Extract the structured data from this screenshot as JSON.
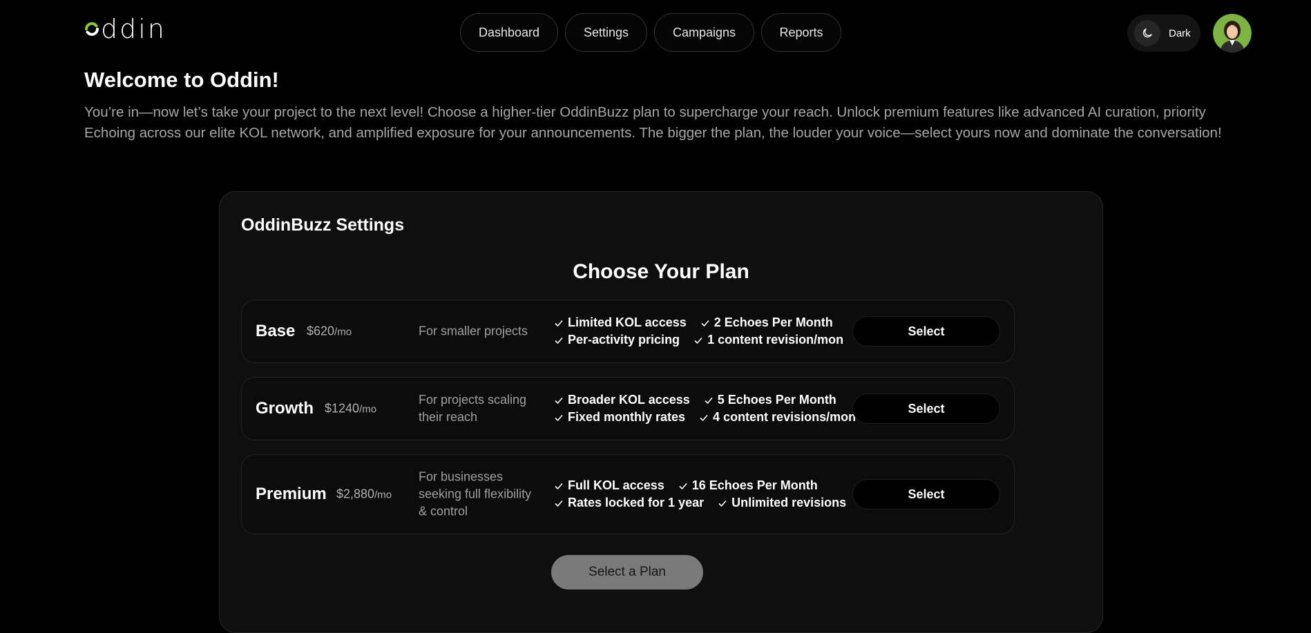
{
  "header": {
    "logo_text": "ddin",
    "nav": [
      "Dashboard",
      "Settings",
      "Campaigns",
      "Reports"
    ],
    "theme_label": "Dark"
  },
  "welcome": {
    "title": "Welcome to Oddin!",
    "text": "You’re in—now let’s take your project to the next level! Choose a higher-tier OddinBuzz plan to supercharge your reach. Unlock premium features like advanced AI curation, priority Echoing across our elite KOL network, and amplified exposure for your announcements. The bigger the plan, the louder your voice—select yours now and dominate the conversation!"
  },
  "card": {
    "title": "OddinBuzz Settings",
    "heading": "Choose Your Plan",
    "plans": [
      {
        "name": "Base",
        "price": "$620",
        "per": "/mo",
        "desc": "For smaller projects",
        "features_row1": [
          "Limited KOL access",
          "2 Echoes Per Month"
        ],
        "features_row2": [
          "Per-activity pricing",
          "1 content revision/mon"
        ],
        "button": "Select"
      },
      {
        "name": "Growth",
        "price": "$1240",
        "per": "/mo",
        "desc": "For projects scaling their reach",
        "features_row1": [
          "Broader KOL access",
          "5 Echoes Per Month"
        ],
        "features_row2": [
          "Fixed monthly rates",
          "4 content revisions/mon"
        ],
        "button": "Select"
      },
      {
        "name": "Premium",
        "price": "$2,880",
        "per": "/mo",
        "desc": "For businesses seeking full flexibility & control",
        "features_row1": [
          "Full KOL access",
          "16 Echoes Per Month"
        ],
        "features_row2": [
          "Rates locked for 1 year",
          "Unlimited revisions"
        ],
        "button": "Select"
      }
    ],
    "submit": "Select a Plan"
  },
  "colors": {
    "accent": "#8dc63f",
    "background": "#000000",
    "card": "#0f0f0f",
    "muted_text": "#a6a6a6"
  },
  "icons": {
    "theme": "moon-icon",
    "feature": "check-icon"
  }
}
